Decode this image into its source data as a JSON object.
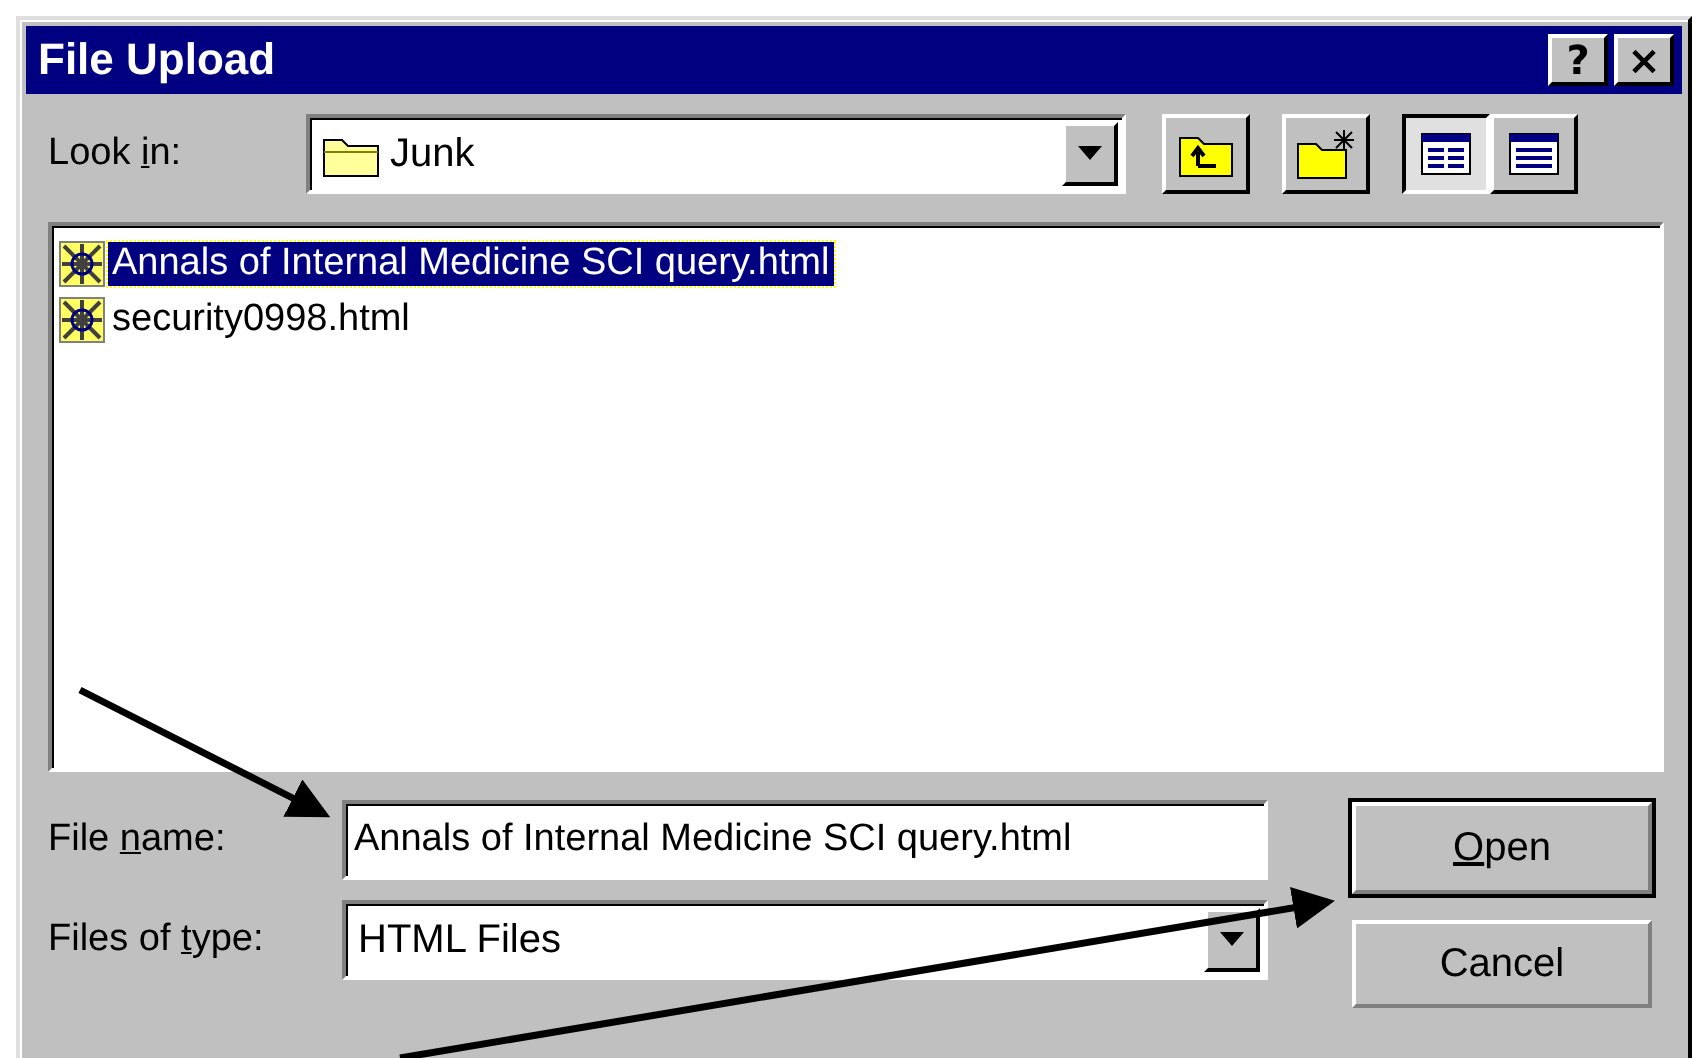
{
  "window": {
    "title": "File Upload",
    "title_buttons": [
      "?",
      "×"
    ]
  },
  "look_in": {
    "label": {
      "before": "Look ",
      "access_key": "i",
      "after": "n:"
    },
    "value": "Junk"
  },
  "toolbar": [
    {
      "kind": "up-folder",
      "selected": false
    },
    {
      "kind": "new-folder",
      "selected": false
    },
    {
      "kind": "list-view",
      "selected": true
    },
    {
      "kind": "details-view",
      "selected": false
    }
  ],
  "files": [
    {
      "name": "Annals of Internal Medicine SCI query.html",
      "selected": true
    },
    {
      "name": "security0998.html",
      "selected": false
    }
  ],
  "file_name": {
    "label": {
      "before": "File ",
      "access_key": "n",
      "after": "ame:"
    },
    "value": "Annals of Internal Medicine SCI query.html"
  },
  "file_type": {
    "label": {
      "before": "Files of ",
      "access_key": "t",
      "after": "ype:"
    },
    "value": "HTML Files"
  },
  "buttons": [
    {
      "label": {
        "access_key": "O",
        "after": "pen"
      },
      "default": true
    },
    {
      "label": {
        "before": "Cancel"
      },
      "default": false
    }
  ]
}
